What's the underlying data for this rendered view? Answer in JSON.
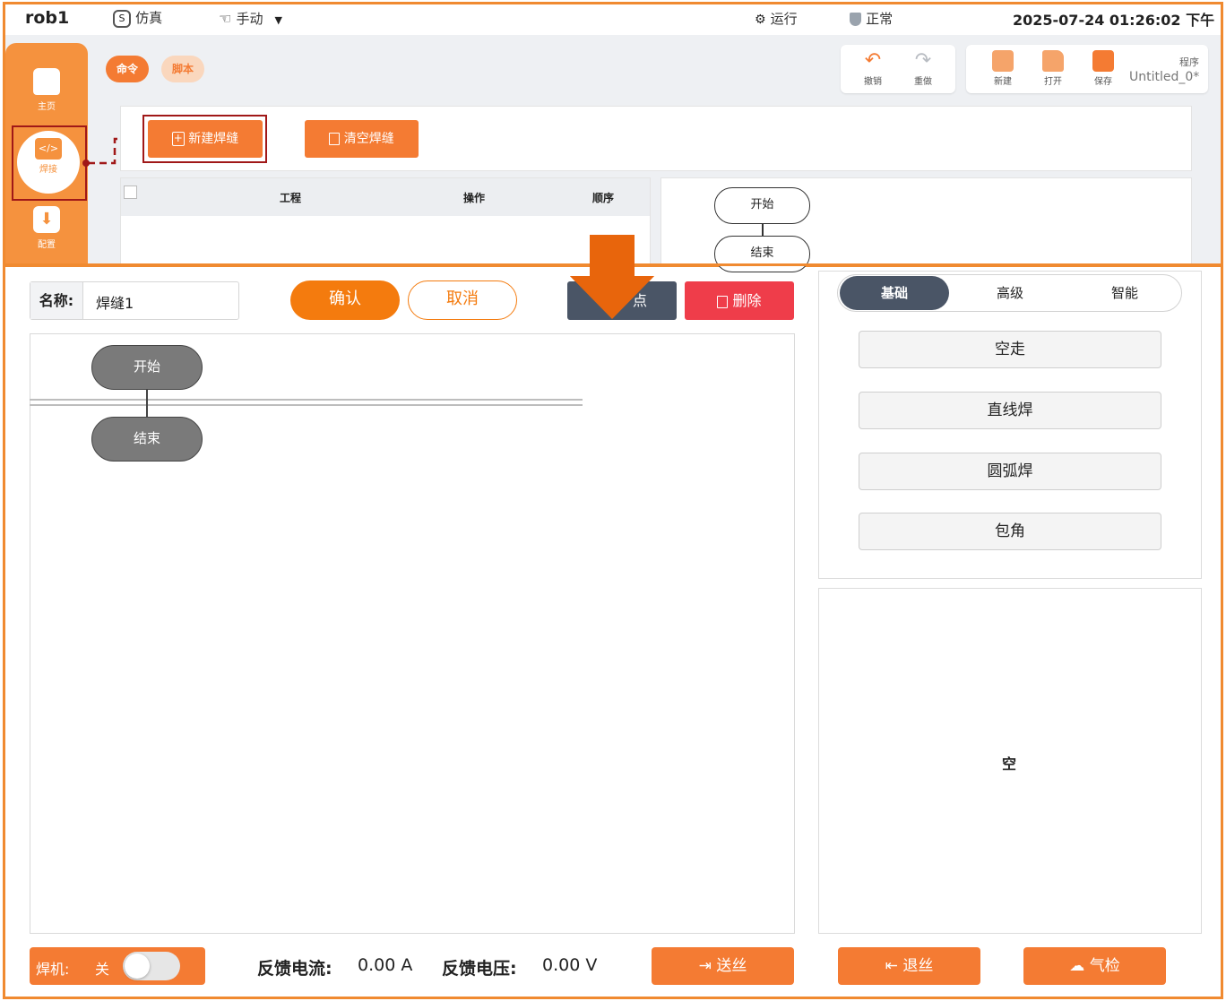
{
  "topbar": {
    "robot": "rob1",
    "sim_label": "仿真",
    "mode_label": "手动",
    "run_label": "运行",
    "status_label": "正常",
    "datetime": "2025-07-24 01:26:02 下午"
  },
  "sidebar": {
    "items": [
      {
        "label": "主页"
      },
      {
        "label": "焊接"
      },
      {
        "label": "配置"
      }
    ]
  },
  "tabs": {
    "command": "命令",
    "script": "脚本"
  },
  "toolbar": {
    "undo": "撤销",
    "redo": "重做",
    "new": "新建",
    "open": "打开",
    "save": "保存",
    "program_label": "程序",
    "program_name": "Untitled_0*"
  },
  "weld_actions": {
    "new_weld": "新建焊缝",
    "clear_weld": "清空焊缝"
  },
  "table": {
    "headers": [
      "工程",
      "操作",
      "顺序"
    ]
  },
  "mini_flow": {
    "start": "开始",
    "end": "结束"
  },
  "editor": {
    "name_label": "名称:",
    "name_value": "焊缝1",
    "confirm": "确认",
    "cancel": "取消",
    "hidden_button_tail": "点",
    "delete": "删除"
  },
  "flow": {
    "start": "开始",
    "end": "结束"
  },
  "right_tabs": {
    "basic": "基础",
    "advanced": "高级",
    "smart": "智能"
  },
  "right_buttons": [
    "空走",
    "直线焊",
    "圆弧焊",
    "包角"
  ],
  "empty_label": "空",
  "bottom": {
    "welder_label": "焊机:",
    "welder_state": "关",
    "current_label": "反馈电流:",
    "current_value": "0.00 A",
    "voltage_label": "反馈电压:",
    "voltage_value": "0.00 V",
    "feed_wire": "送丝",
    "retract_wire": "退丝",
    "gas_check": "气检"
  },
  "colors": {
    "accent": "#f47b33",
    "frame": "#f08a30",
    "dark": "#4a5566",
    "danger": "#ef3d4a"
  }
}
